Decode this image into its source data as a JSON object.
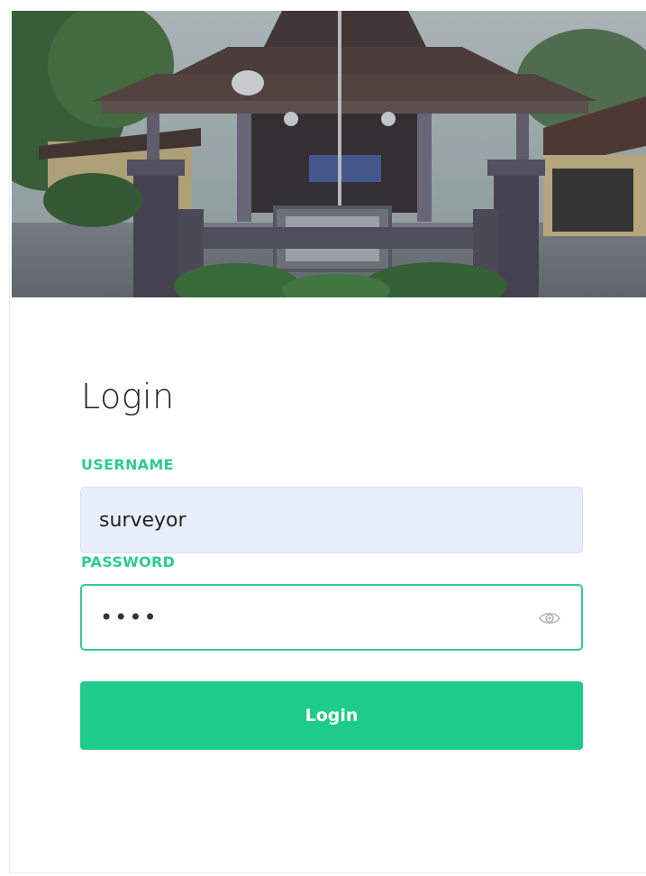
{
  "hero": {
    "image_semantic": "traditional-javanese-pendopo-building-photo"
  },
  "login": {
    "title": "Login",
    "username": {
      "label": "USERNAME",
      "value": "surveyor"
    },
    "password": {
      "label": "PASSWORD",
      "masked_value": "••••",
      "toggle_icon": "eye-icon"
    },
    "submit_label": "Login"
  },
  "colors": {
    "accent": "#1ecb8a",
    "label_green": "#2ecc8e",
    "autofill_bg": "#e8eefb",
    "focus_border": "#35c995"
  }
}
